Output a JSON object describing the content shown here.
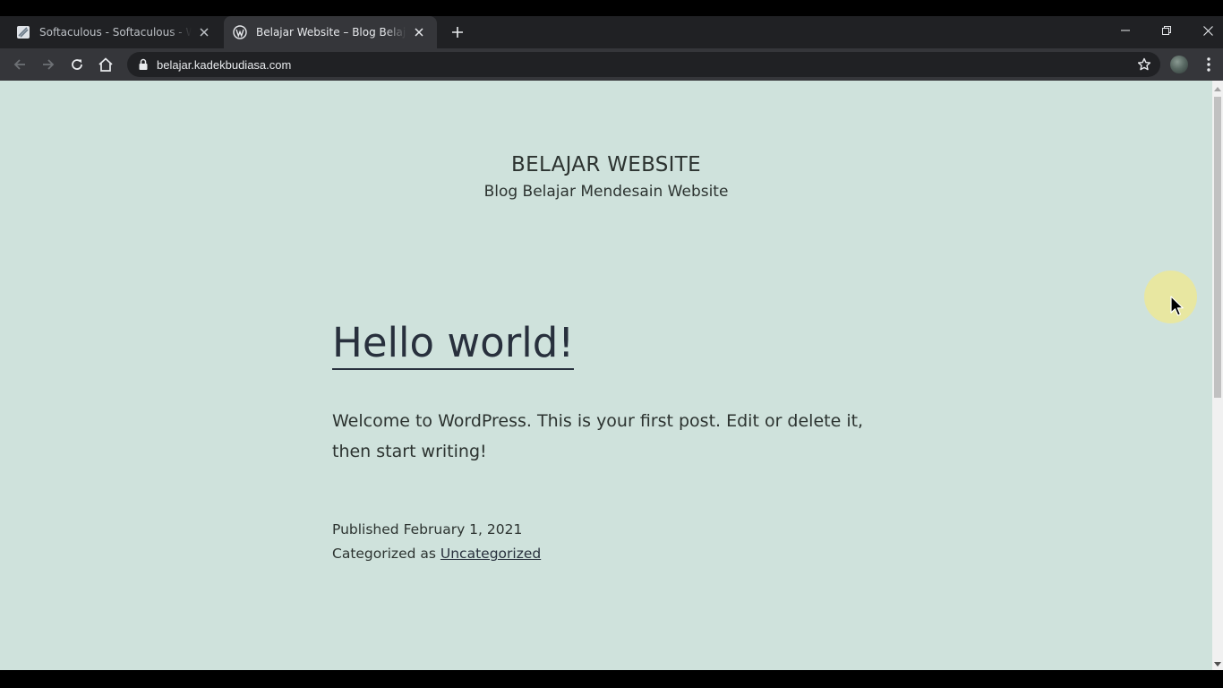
{
  "browser": {
    "tabs": [
      {
        "title": "Softaculous - Softaculous - WordPress",
        "active": false,
        "favicon": "softaculous-icon"
      },
      {
        "title": "Belajar Website – Blog Belajar Mendesain Website",
        "active": true,
        "favicon": "wordpress-icon"
      }
    ],
    "new_tab_icon": "plus-icon",
    "window_controls": [
      "minimize-icon",
      "restore-icon",
      "close-icon"
    ],
    "nav_icons": [
      "back-arrow-icon",
      "forward-arrow-icon",
      "reload-icon",
      "home-icon"
    ],
    "address": "belajar.kadekbudiasa.com",
    "lock_icon": "lock-icon",
    "bookmark_icon": "star-icon",
    "menu_icon": "kebab-menu-icon"
  },
  "page": {
    "site_title": "BELAJAR WEBSITE",
    "site_description": "Blog Belajar Mendesain Website",
    "post": {
      "title": "Hello world!",
      "content": "Welcome to WordPress. This is your first post. Edit or delete it, then start writing!",
      "published_label": "Published",
      "published_date": "February 1, 2021",
      "category_label": "Categorized as",
      "category": "Uncategorized"
    },
    "background_color": "#cfe2dc"
  }
}
